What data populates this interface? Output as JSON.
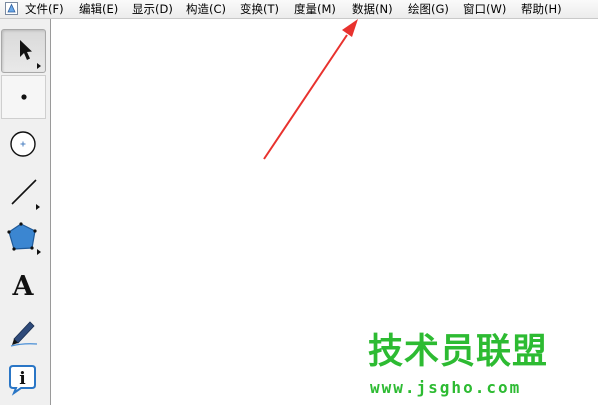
{
  "menubar": {
    "items": [
      "文件(F)",
      "编辑(E)",
      "显示(D)",
      "构造(C)",
      "变换(T)",
      "度量(M)",
      "数据(N)",
      "绘图(G)",
      "窗口(W)",
      "帮助(H)"
    ]
  },
  "toolbox": {
    "tools": [
      {
        "name": "arrow-select-tool",
        "icon": "arrow-pointer-icon",
        "selected": true
      },
      {
        "name": "point-tool",
        "icon": "point-icon",
        "selected": false
      },
      {
        "name": "compass-tool",
        "icon": "circle-icon",
        "selected": false
      },
      {
        "name": "straightedge-tool",
        "icon": "line-segment-icon",
        "selected": false
      },
      {
        "name": "polygon-tool",
        "icon": "pentagon-icon",
        "selected": false
      },
      {
        "name": "text-tool",
        "icon": "letter-a-icon",
        "label": "A",
        "selected": false
      },
      {
        "name": "marker-tool",
        "icon": "pen-icon",
        "selected": false
      },
      {
        "name": "information-tool",
        "icon": "info-icon",
        "label": "i",
        "selected": false
      }
    ]
  },
  "annotation": {
    "icon": "red-arrow-icon",
    "color": "#e8322e",
    "points_to": "数据(N)"
  },
  "watermark": {
    "title": "技术员联盟",
    "url": "www.jsgho.com",
    "color": "#2dbb32"
  }
}
